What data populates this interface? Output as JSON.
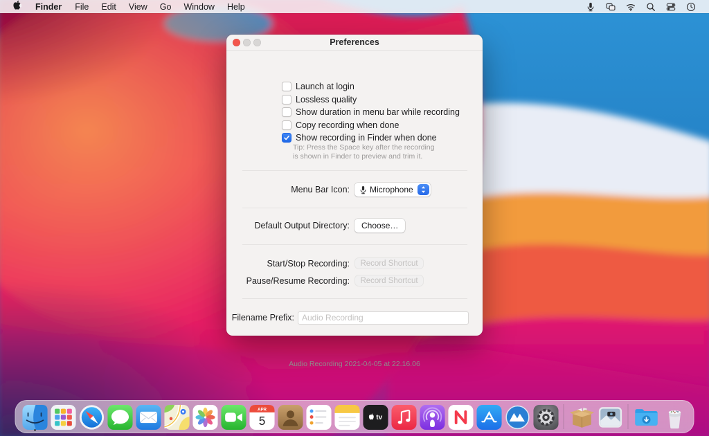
{
  "menu_bar": {
    "apple_logo_icon": "apple-logo",
    "items": [
      "Finder",
      "File",
      "Edit",
      "View",
      "Go",
      "Window",
      "Help"
    ],
    "status_icons": [
      "microphone",
      "screen-mirroring",
      "wifi",
      "spotlight-search",
      "control-center",
      "clock"
    ]
  },
  "window": {
    "title": "Preferences",
    "checkboxes": [
      {
        "label": "Launch at login",
        "checked": false
      },
      {
        "label": "Lossless quality",
        "checked": false
      },
      {
        "label": "Show duration in menu bar while recording",
        "checked": false
      },
      {
        "label": "Copy recording when done",
        "checked": false
      },
      {
        "label": "Show recording in Finder when done",
        "checked": true
      }
    ],
    "tip_line1": "Tip: Press the Space key after the recording",
    "tip_line2": "is shown in Finder to preview and trim it.",
    "menu_bar_icon_row": {
      "label": "Menu Bar Icon:",
      "value": "Microphone",
      "icon": "microphone-icon"
    },
    "output_directory_row": {
      "label": "Default Output Directory:",
      "button": "Choose…"
    },
    "shortcut_rows": [
      {
        "label": "Start/Stop Recording:",
        "button": "Record Shortcut"
      },
      {
        "label": "Pause/Resume Recording:",
        "button": "Record Shortcut"
      }
    ],
    "filename_row": {
      "label": "Filename Prefix:",
      "placeholder": "Audio Recording"
    },
    "filename_example": "Audio Recording 2021-04-05 at 22.16.06"
  },
  "dock": {
    "items": [
      {
        "name": "finder",
        "running": true
      },
      {
        "name": "launchpad"
      },
      {
        "name": "safari"
      },
      {
        "name": "messages"
      },
      {
        "name": "mail"
      },
      {
        "name": "maps"
      },
      {
        "name": "photos"
      },
      {
        "name": "facetime"
      },
      {
        "name": "calendar",
        "month": "APR",
        "day": "5"
      },
      {
        "name": "contacts"
      },
      {
        "name": "reminders"
      },
      {
        "name": "notes"
      },
      {
        "name": "apple-tv"
      },
      {
        "name": "music"
      },
      {
        "name": "podcasts"
      },
      {
        "name": "news"
      },
      {
        "name": "app-store"
      },
      {
        "name": "mountain-app"
      },
      {
        "name": "system-preferences"
      },
      {
        "name": "divider"
      },
      {
        "name": "unarchiver-box"
      },
      {
        "name": "disk-image"
      },
      {
        "name": "divider"
      },
      {
        "name": "downloads-folder"
      },
      {
        "name": "trash-full"
      }
    ]
  },
  "colors": {
    "accent_blue": "#2568e8",
    "checkbox_checked": "#1f68e8",
    "close_button": "#f3564c",
    "window_bg": "#f4f2f1"
  }
}
